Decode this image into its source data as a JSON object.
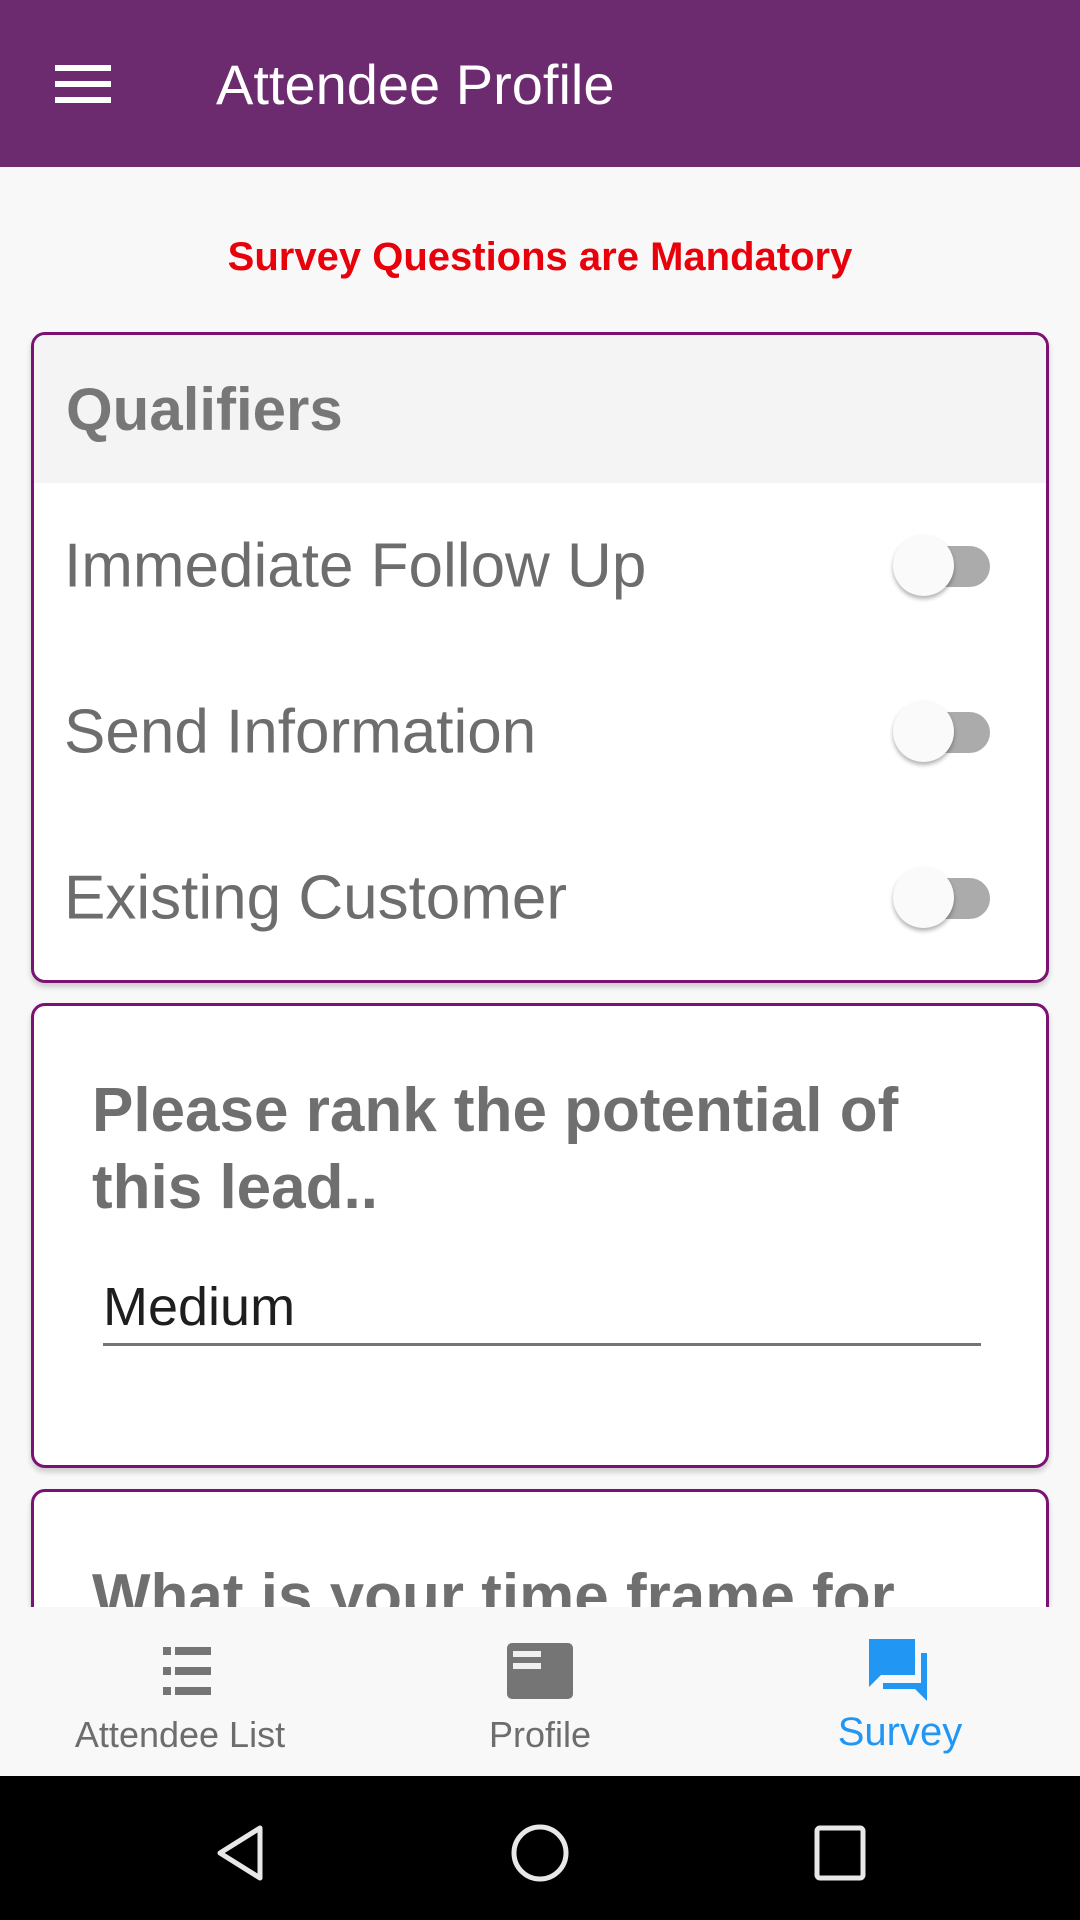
{
  "app_bar": {
    "title": "Attendee Profile",
    "menu_icon": "hamburger-menu-icon",
    "background_color": "#6c2a6f"
  },
  "notice": {
    "text": "Survey Questions are Mandatory",
    "color": "#e8000b"
  },
  "qualifiers": {
    "title": "Qualifiers",
    "items": [
      {
        "label": "Immediate Follow Up",
        "checked": false
      },
      {
        "label": "Send Information",
        "checked": false
      },
      {
        "label": "Existing Customer",
        "checked": false
      }
    ]
  },
  "questions": [
    {
      "title": "Please rank the potential of this lead..",
      "value": "Medium"
    },
    {
      "title": "What is your time frame for"
    }
  ],
  "bottom_nav": {
    "items": [
      {
        "label": "Attendee List",
        "icon": "list-icon",
        "active": false
      },
      {
        "label": "Profile",
        "icon": "profile-card-icon",
        "active": false
      },
      {
        "label": "Survey",
        "icon": "chat-bubbles-icon",
        "active": true
      }
    ],
    "active_color": "#2196f3"
  },
  "system_nav": {
    "buttons": [
      "back-icon",
      "home-icon",
      "recents-icon"
    ]
  }
}
